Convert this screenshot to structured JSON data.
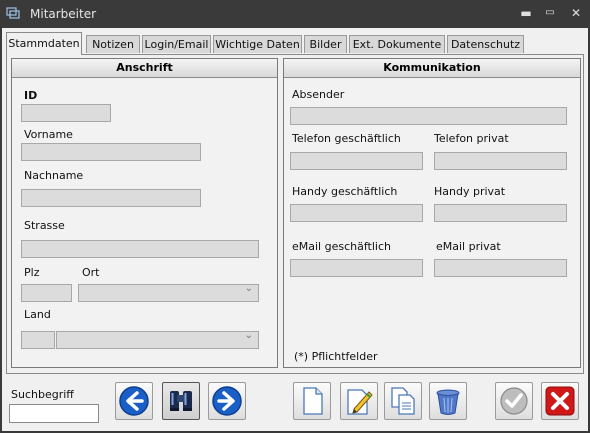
{
  "window": {
    "title": "Mitarbeiter",
    "controls": [
      "minimize",
      "maximize",
      "close"
    ]
  },
  "tabs": [
    {
      "label": "Stammdaten",
      "active": true
    },
    {
      "label": "Notizen",
      "active": false
    },
    {
      "label": "Login/Email",
      "active": false
    },
    {
      "label": "Wichtige Daten",
      "active": false
    },
    {
      "label": "Bilder",
      "active": false
    },
    {
      "label": "Ext. Dokumente",
      "active": false
    },
    {
      "label": "Datenschutz",
      "active": false
    }
  ],
  "anschrift": {
    "title": "Anschrift",
    "id_label": "ID",
    "vorname_label": "Vorname",
    "nachname_label": "Nachname",
    "strasse_label": "Strasse",
    "plz_label": "Plz",
    "ort_label": "Ort",
    "land_label": "Land"
  },
  "kommunikation": {
    "title": "Kommunikation",
    "absender_label": "Absender",
    "tel_geschaeft_label": "Telefon geschäftlich",
    "tel_privat_label": "Telefon privat",
    "handy_geschaeft_label": "Handy geschäftlich",
    "handy_privat_label": "Handy privat",
    "email_geschaeft_label": "eMail geschäftlich",
    "email_privat_label": "eMail privat",
    "pflicht_note": "(*) Pflichtfelder"
  },
  "bottom": {
    "suchbegriff_label": "Suchbegriff",
    "suchbegriff_value": ""
  },
  "icons": [
    "back-arrow-icon",
    "binoculars-icon",
    "forward-arrow-icon",
    "new-document-icon",
    "edit-document-icon",
    "copy-document-icon",
    "trash-icon",
    "confirm-check-icon",
    "cancel-x-icon"
  ],
  "colors": {
    "titlebar": "#3a3a3a",
    "arrow_blue": "#1a5fc8",
    "cancel_red": "#d01818",
    "field_bg": "#dcdcdc"
  }
}
